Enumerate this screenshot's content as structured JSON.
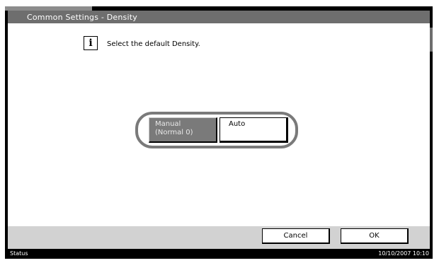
{
  "window": {
    "title": "Common Settings - Density"
  },
  "message": {
    "icon": "info-icon",
    "text": "Select the default Density."
  },
  "density_options": {
    "manual_label_line1": "Manual",
    "manual_label_line2": "(Normal 0)",
    "auto_label": "Auto",
    "selected": "Auto"
  },
  "footer": {
    "cancel_label": "Cancel",
    "ok_label": "OK"
  },
  "statusbar": {
    "status_label": "Status",
    "datetime": "10/10/2007  10:10"
  },
  "colors": {
    "title_bar": "#6e6e6e",
    "button_dark": "#7a7a7a",
    "footer_bar": "#d2d2d2"
  }
}
